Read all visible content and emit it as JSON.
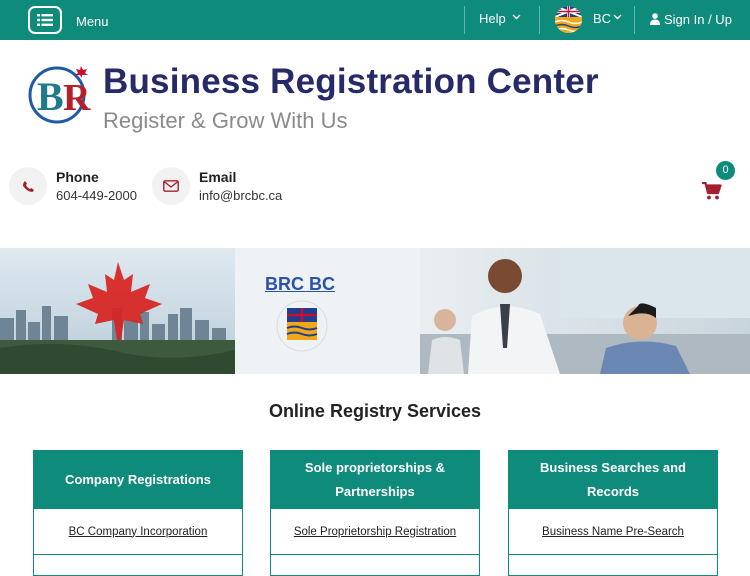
{
  "topbar": {
    "menu_label": "Menu",
    "help_label": "Help",
    "region_label": "BC",
    "signin_label": "Sign In / Up"
  },
  "header": {
    "logo_text": "BR",
    "title": "Business Registration Center",
    "subtitle": "Register & Grow With Us"
  },
  "contacts": [
    {
      "title": "Phone",
      "value": "604-449-2000",
      "icon": "phone-icon"
    },
    {
      "title": "Email",
      "value": "info@brcbc.ca",
      "icon": "envelope-icon"
    }
  ],
  "cart": {
    "count": "0",
    "icon": "cart-icon"
  },
  "banner": {
    "title": "BRC BC"
  },
  "services": {
    "title": "Online Registry Services",
    "cards": [
      {
        "heading": "Company Registrations",
        "link": "BC Company Incorporation"
      },
      {
        "heading": "Sole proprietorships & Partnerships",
        "link": "Sole Proprietorship Registration"
      },
      {
        "heading": "Business Searches and Records",
        "link": "Business Name Pre-Search"
      }
    ]
  },
  "colors": {
    "primary": "#0f8b7b",
    "brand_navy": "#262a68",
    "accent_red": "#a5202e"
  }
}
